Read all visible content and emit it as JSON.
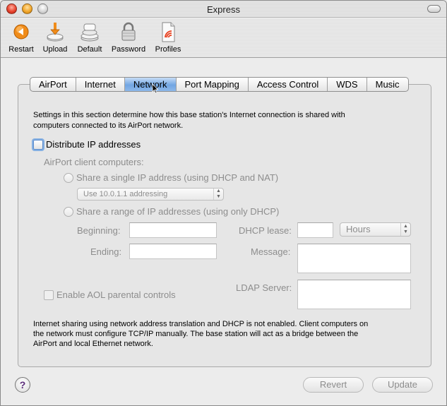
{
  "window": {
    "title": "Express"
  },
  "toolbar": {
    "items": [
      {
        "label": "Restart",
        "icon": "restart-icon"
      },
      {
        "label": "Upload",
        "icon": "upload-icon"
      },
      {
        "label": "Default",
        "icon": "default-icon"
      },
      {
        "label": "Password",
        "icon": "lock-icon"
      },
      {
        "label": "Profiles",
        "icon": "profiles-icon"
      }
    ]
  },
  "tabs": [
    {
      "label": "AirPort"
    },
    {
      "label": "Internet"
    },
    {
      "label": "Network",
      "selected": true
    },
    {
      "label": "Port Mapping"
    },
    {
      "label": "Access Control"
    },
    {
      "label": "WDS"
    },
    {
      "label": "Music"
    }
  ],
  "network": {
    "intro_line1": "Settings in this section determine how this base station's Internet connection is shared with",
    "intro_line2": "computers connected to its AirPort network.",
    "distribute_label": "Distribute IP addresses",
    "distribute_checked": false,
    "client_heading": "AirPort client computers:",
    "option_single": "Share a single IP address (using DHCP and NAT)",
    "addressing_popup": "Use 10.0.1.1 addressing",
    "option_range": "Share a range of IP addresses (using only DHCP)",
    "beginning_label": "Beginning:",
    "beginning_value": "",
    "ending_label": "Ending:",
    "ending_value": "",
    "lease_label": "DHCP lease:",
    "lease_value": "",
    "lease_unit": "Hours",
    "message_label": "Message:",
    "message_value": "",
    "ldap_label": "LDAP Server:",
    "ldap_value": "",
    "aol_label": "Enable AOL parental controls",
    "aol_checked": false,
    "status_line1": "Internet sharing using network address translation and DHCP is not enabled. Client computers on",
    "status_line2": "the network must configure TCP/IP manually. The base station will act as a bridge between the",
    "status_line3": "AirPort and local Ethernet network."
  },
  "footer": {
    "help_label": "?",
    "revert_label": "Revert",
    "update_label": "Update"
  },
  "colors": {
    "selected_tab": "#72a6e3",
    "disabled_text": "#8d8d8d",
    "help_glyph": "#5b2c7a"
  }
}
